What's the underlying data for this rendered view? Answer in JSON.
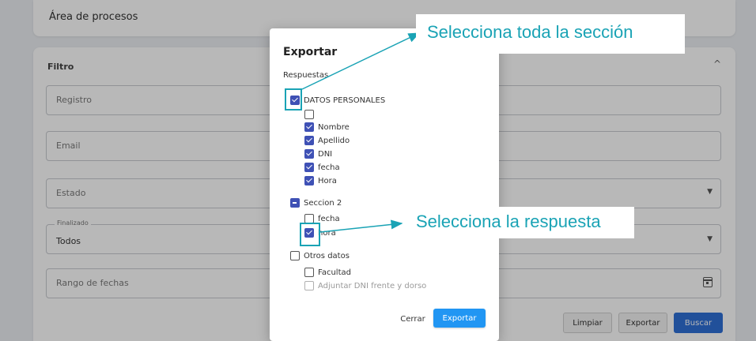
{
  "background": {
    "process_area_title": "Área de procesos",
    "filter_title": "Filtro",
    "filter_caret": "^",
    "fields": {
      "registro_label": "Registro",
      "email_label": "Email",
      "estado_label": "Estado",
      "finalizado_legend": "Finalizado",
      "finalizado_value": "Todos",
      "rango_label": "Rango de fechas"
    },
    "buttons": {
      "limpiar": "Limpiar",
      "exportar": "Exportar",
      "buscar": "Buscar"
    }
  },
  "modal": {
    "title": "Exportar",
    "subtitle": "Respuestas",
    "items": {
      "datos_personales": "DATOS PERSONALES",
      "blank": "",
      "nombre": "Nombre",
      "apellido": "Apellido",
      "dni": "DNI",
      "fecha1": "fecha",
      "hora1": "Hora",
      "seccion2": "Seccion 2",
      "fecha2": "fecha",
      "hora2": "hora",
      "otros_datos": "Otros datos",
      "facultad": "Facultad",
      "adjuntar": "Adjuntar DNI frente y dorso"
    },
    "cerrar": "Cerrar",
    "exportar": "Exportar"
  },
  "annotations": {
    "callout_1": "Selecciona toda la sección",
    "callout_2": "Selecciona la respuesta"
  },
  "colors": {
    "checkbox": "#3f51b5",
    "primary_button": "#2196f3",
    "annotation": "#1aa3b5"
  }
}
